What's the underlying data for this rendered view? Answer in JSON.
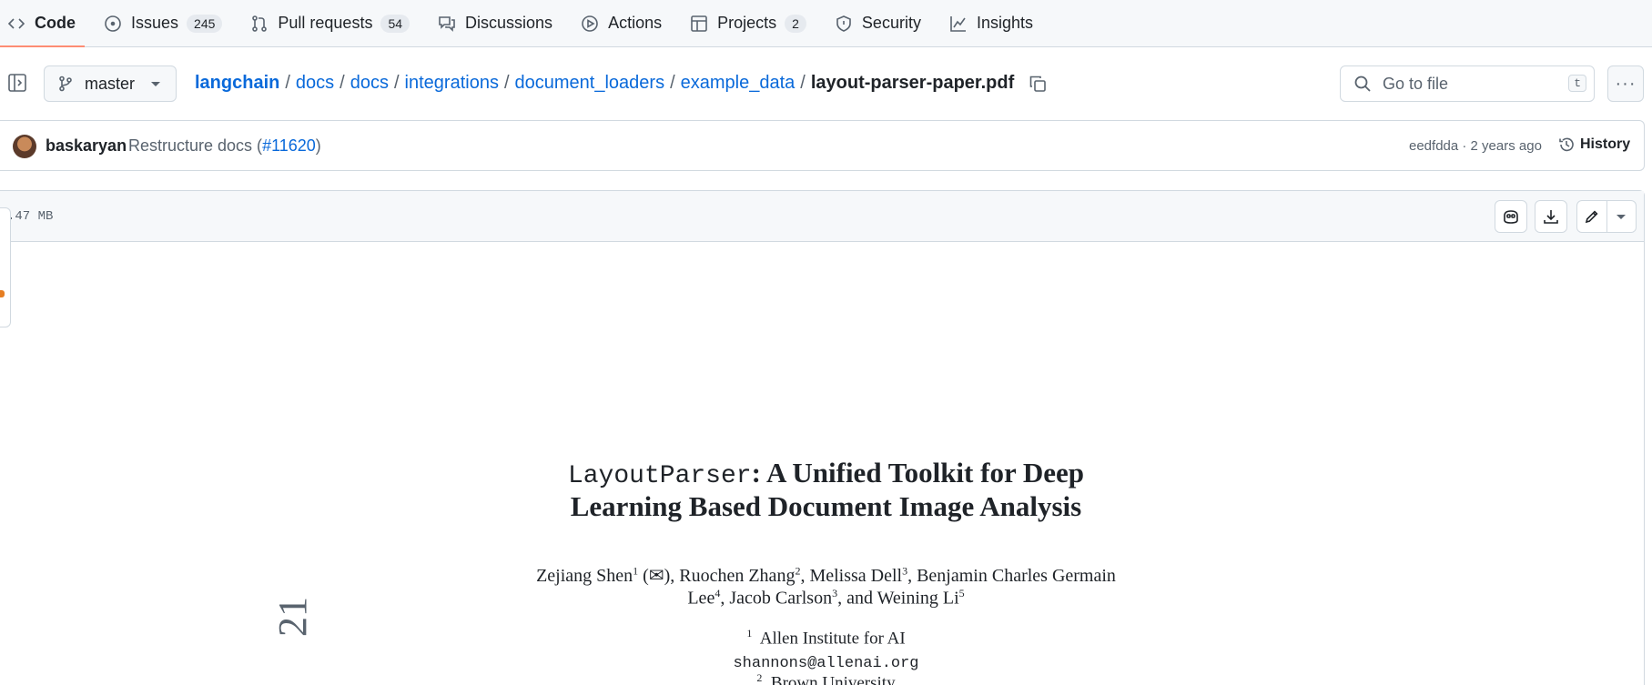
{
  "nav": {
    "code": "Code",
    "issues": "Issues",
    "issues_count": "245",
    "pulls": "Pull requests",
    "pulls_count": "54",
    "discussions": "Discussions",
    "actions": "Actions",
    "projects": "Projects",
    "projects_count": "2",
    "security": "Security",
    "insights": "Insights"
  },
  "branch": "master",
  "breadcrumb": {
    "repo": "langchain",
    "parts": [
      "docs",
      "docs",
      "integrations",
      "document_loaders",
      "example_data"
    ],
    "separator": "/",
    "current": "layout-parser-paper.pdf"
  },
  "search": {
    "placeholder": "Go to file",
    "shortcut": "t"
  },
  "more_label": "···",
  "commit": {
    "author": "baskaryan",
    "message": "Restructure docs (",
    "pr": "#11620",
    "message_end": ")",
    "meta": "eedfdda · 2 years ago",
    "history": "History"
  },
  "file": {
    "size": ".47 MB"
  },
  "pdf": {
    "title_mono": "LayoutParser",
    "title_line1_rest": ": A Unified Toolkit for Deep",
    "title_line2": "Learning Based Document Image Analysis",
    "authors": [
      {
        "name": "Zejiang Shen",
        "sup": "1",
        "after": " (✉), "
      },
      {
        "name": "Ruochen Zhang",
        "sup": "2",
        "after": ", "
      },
      {
        "name": "Melissa Dell",
        "sup": "3",
        "after": ", Benjamin Charles Germain"
      }
    ],
    "authors_line2": [
      {
        "name": "Lee",
        "sup": "4",
        "after": ", "
      },
      {
        "name": "Jacob Carlson",
        "sup": "3",
        "after": ", and "
      },
      {
        "name": "Weining Li",
        "sup": "5",
        "after": ""
      }
    ],
    "affil1_sup": "1",
    "affil1": "Allen Institute for AI",
    "email1": "shannons@allenai.org",
    "affil2_sup": "2",
    "affil2": "Brown University",
    "margin_text": "21"
  },
  "colors": {
    "accent": "#0969da",
    "nav_underline": "#fd8c73"
  }
}
